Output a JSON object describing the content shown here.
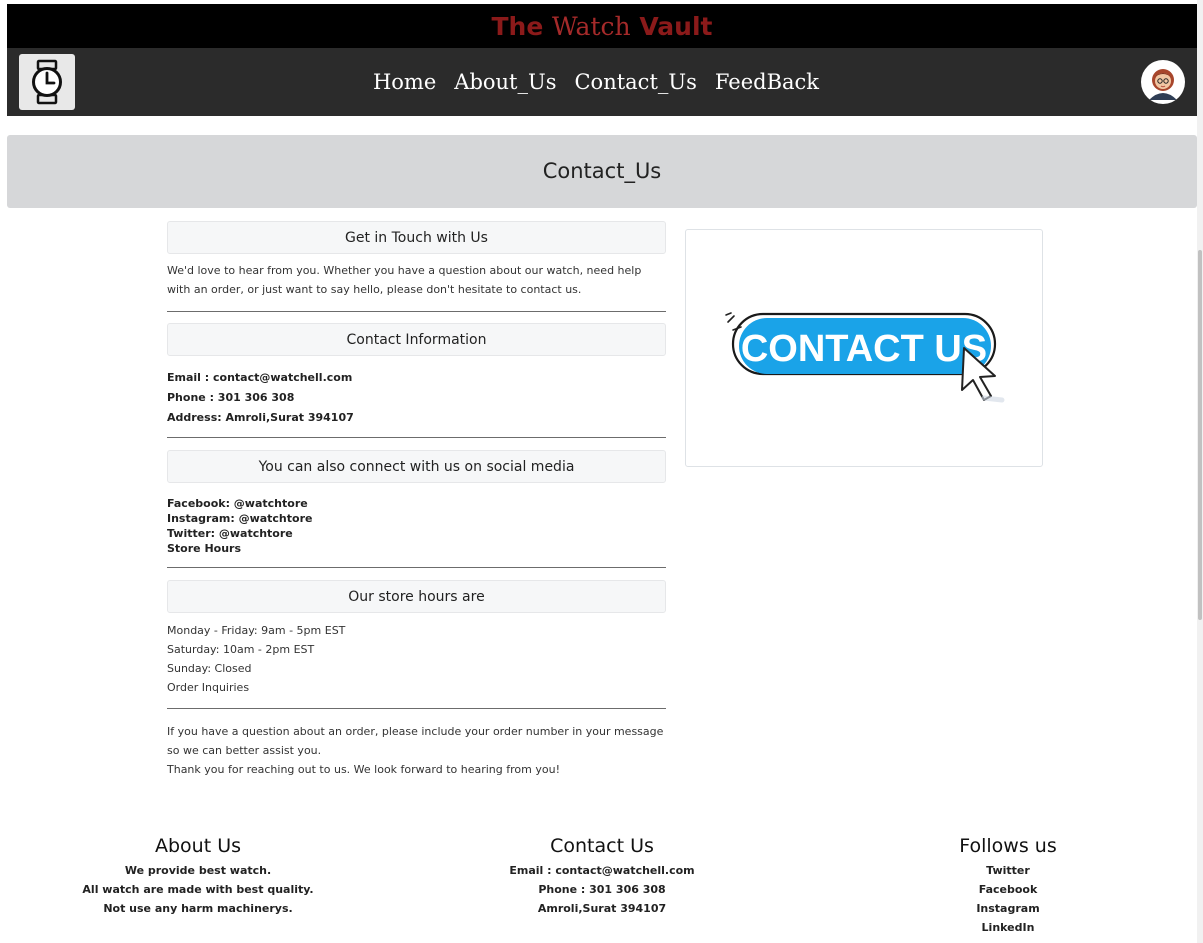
{
  "brand": {
    "part1": "The",
    "part2": "Watch",
    "part3": "Vault"
  },
  "nav": {
    "links": [
      "Home",
      "About_Us",
      "Contact_Us",
      "FeedBack"
    ],
    "logo_icon": "watch-icon",
    "avatar_icon": "user-avatar"
  },
  "page": {
    "title": "Contact_Us"
  },
  "sections": {
    "touch": {
      "heading": "Get in Touch with Us",
      "text": "We'd love to hear from you. Whether you have a question about our watch, need help with an order, or just want to say hello, please don't hesitate to contact us."
    },
    "contact": {
      "heading": "Contact Information",
      "email": "Email : contact@watchell.com",
      "phone": "Phone : 301 306 308",
      "address": "Address: Amroli,Surat 394107"
    },
    "social": {
      "heading": "You can also connect with us on social media",
      "facebook": "Facebook: @watchtore",
      "instagram": "Instagram: @watchtore",
      "twitter": "Twitter: @watchtore",
      "store_hours": "Store Hours"
    },
    "hours": {
      "heading": "Our store hours are",
      "weekday": "Monday - Friday: 9am - 5pm EST",
      "saturday": "Saturday: 10am - 2pm EST",
      "sunday": "Sunday: Closed",
      "order_inquiries": "Order Inquiries"
    },
    "closing": {
      "line1": "If you have a question about an order, please include your order number in your message so we can better assist you.",
      "line2": "Thank you for reaching out to us. We look forward to hearing from you!"
    }
  },
  "contact_image": {
    "text": "CONTACT US",
    "color": "#1aa3e8"
  },
  "footer": {
    "about": {
      "title": "About Us",
      "lines": [
        "We provide best watch.",
        "All watch are made with best quality.",
        "Not use any harm machinerys."
      ]
    },
    "contact": {
      "title": "Contact Us",
      "lines": [
        "Email : contact@watchell.com",
        "Phone : 301 306 308",
        "Amroli,Surat 394107"
      ]
    },
    "follow": {
      "title": "Follows us",
      "links": [
        "Twitter",
        "Facebook",
        "Instagram",
        "LinkedIn"
      ]
    }
  }
}
